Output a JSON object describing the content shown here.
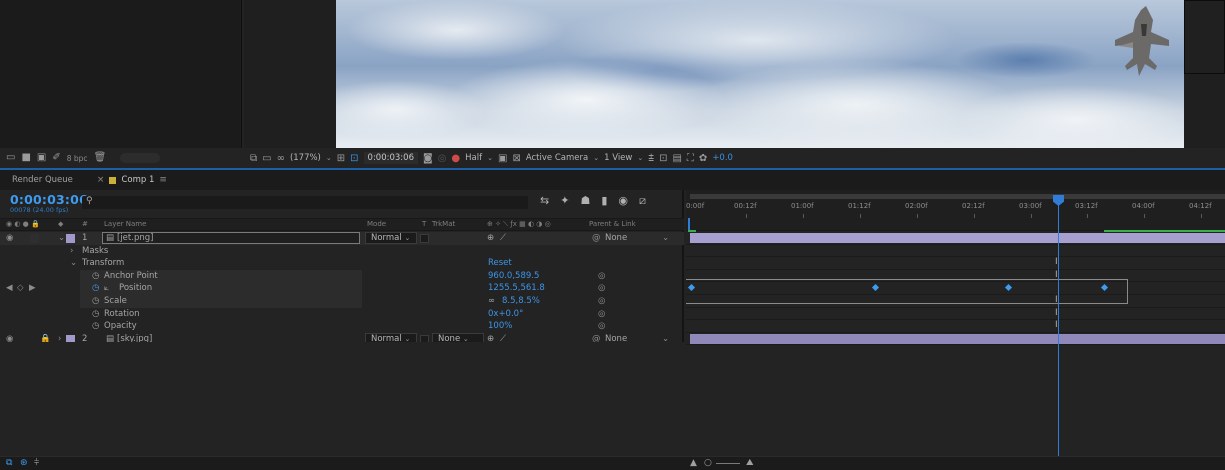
{
  "project": {
    "bpc": "8 bpc"
  },
  "viewer": {
    "zoom": "(177%)",
    "timecode": "0:00:03:06",
    "resolution": "Half",
    "camera": "Active Camera",
    "view": "1 View",
    "exposure": "+0.0"
  },
  "tabs": [
    {
      "label": "Render Queue"
    },
    {
      "label": "Comp 1",
      "active": true,
      "swatch_color": "#c9b13a"
    }
  ],
  "timeline": {
    "current_time": "0:00:03:06",
    "frames_fps": "00078 (24.00 fps)",
    "columns": {
      "number": "#",
      "layer_name": "Layer Name",
      "mode": "Mode",
      "t": "T",
      "trkmat": "TrkMat",
      "parent_link": "Parent & Link"
    },
    "layers": [
      {
        "number": "1",
        "name": "[jet.png]",
        "mode": "Normal",
        "parent": "None",
        "color": "#a199c9"
      },
      {
        "number": "2",
        "name": "[sky.jpg]",
        "mode": "Normal",
        "trkmat": "None",
        "parent": "None",
        "color": "#a199c9"
      }
    ],
    "groups": {
      "masks": "Masks",
      "transform": "Transform",
      "reset": "Reset"
    },
    "properties": [
      {
        "name": "Anchor Point",
        "value": "960.0,589.5"
      },
      {
        "name": "Position",
        "value": "1255.5,561.8"
      },
      {
        "name": "Scale",
        "value": "8.5,8.5%"
      },
      {
        "name": "Rotation",
        "value": "0x+0.0°"
      },
      {
        "name": "Opacity",
        "value": "100%"
      }
    ],
    "ruler_ticks": [
      "0:00f",
      "00:12f",
      "01:00f",
      "01:12f",
      "02:00f",
      "02:12f",
      "03:00f",
      "03:12f",
      "04:00f",
      "04:12f"
    ]
  },
  "colors": {
    "accent_blue": "#3d9bf0",
    "layer_bar": "#8f88b8",
    "playhead": "#2f7dd6",
    "label_yellow": "#c9b13a"
  }
}
